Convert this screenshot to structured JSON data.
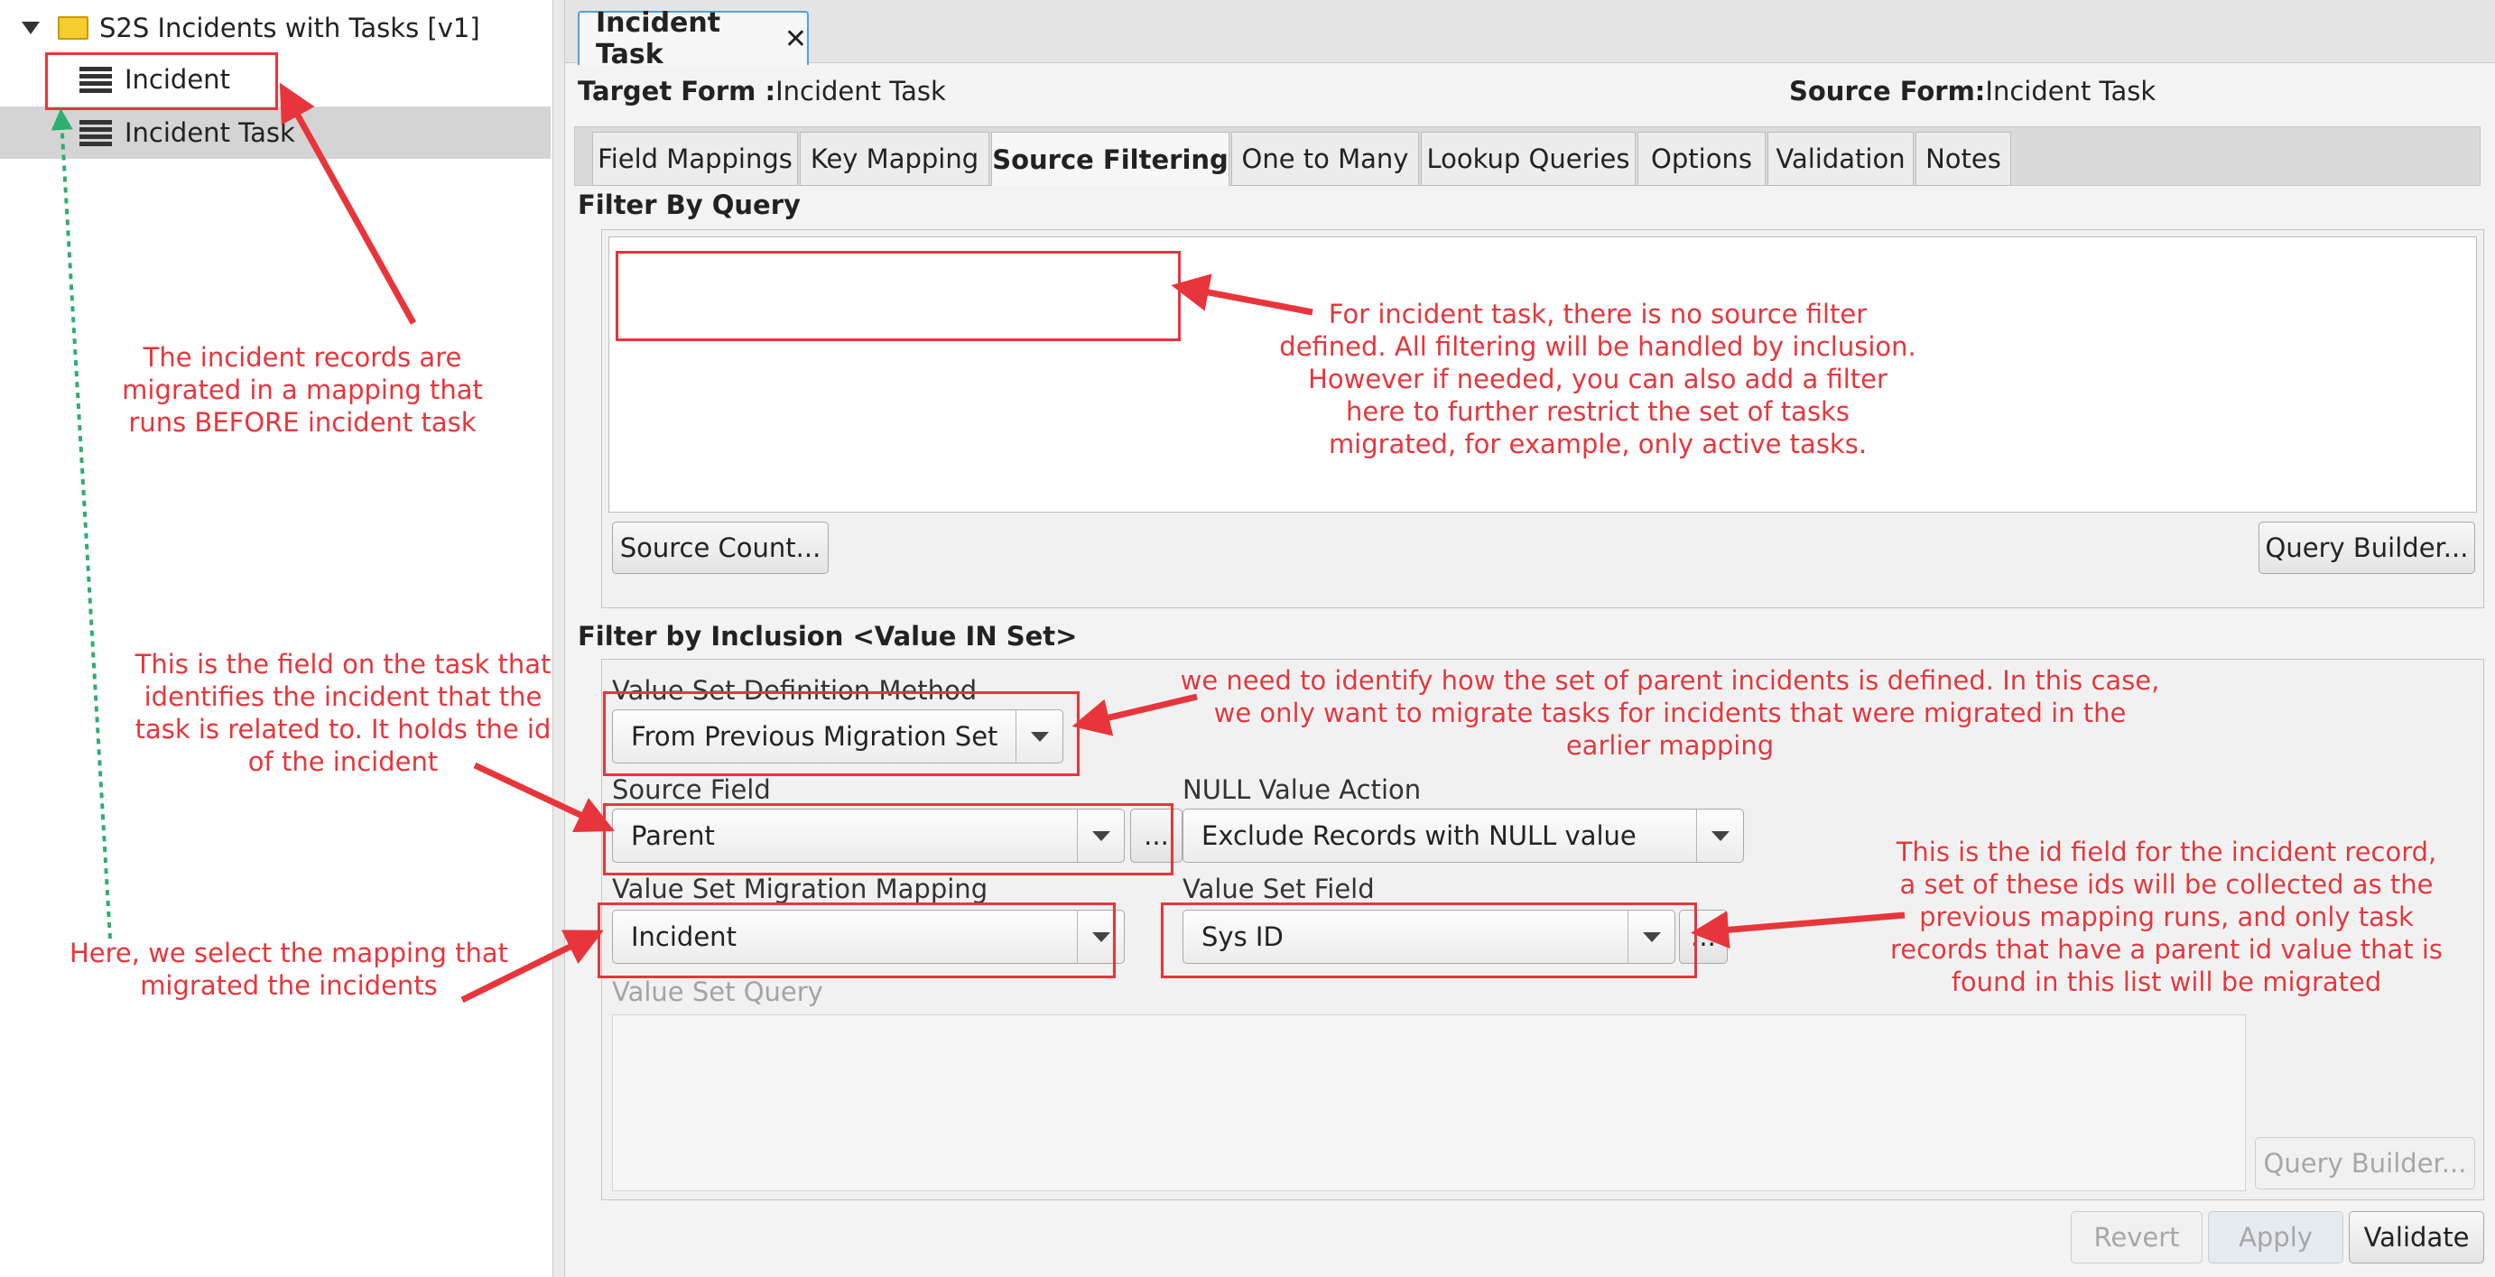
{
  "tree": {
    "root_label": "S2S Incidents with Tasks [v1]",
    "items": [
      {
        "label": "Incident"
      },
      {
        "label": "Incident Task"
      }
    ]
  },
  "document_tab": {
    "label": "Incident Task",
    "close": "✕"
  },
  "header": {
    "target_form_label": "Target Form :",
    "target_form_value": "Incident Task",
    "source_form_label": "Source Form:",
    "source_form_value": "Incident Task"
  },
  "tabs": [
    {
      "label": "Field Mappings"
    },
    {
      "label": "Key Mapping"
    },
    {
      "label": "Source Filtering"
    },
    {
      "label": "One to Many"
    },
    {
      "label": "Lookup Queries"
    },
    {
      "label": "Options"
    },
    {
      "label": "Validation"
    },
    {
      "label": "Notes"
    }
  ],
  "filter_by_query": {
    "title": "Filter By Query",
    "query_value": "",
    "source_count_button": "Source Count...",
    "query_builder_button": "Query Builder..."
  },
  "filter_by_inclusion": {
    "title": "Filter by Inclusion <Value IN Set>",
    "value_set_definition_method_label": "Value Set Definition Method",
    "value_set_definition_method_value": "From Previous Migration Set",
    "source_field_label": "Source Field",
    "source_field_value": "Parent",
    "ellipsis": "...",
    "null_value_action_label": "NULL Value Action",
    "null_value_action_value": "Exclude Records with NULL value",
    "value_set_migration_mapping_label": "Value Set Migration Mapping",
    "value_set_migration_mapping_value": "Incident",
    "value_set_field_label": "Value Set Field",
    "value_set_field_value": "Sys ID",
    "value_set_query_label": "Value Set Query",
    "query_builder_button": "Query Builder..."
  },
  "footer": {
    "revert": "Revert",
    "apply": "Apply",
    "validate": "Validate"
  },
  "annotations": {
    "incident_note": [
      "The incident records are",
      "migrated in a mapping that",
      "runs BEFORE incident task"
    ],
    "source_filter_note": [
      "For incident task, there is no source filter",
      "defined. All filtering will be handled by inclusion.",
      "However if needed, you can also add a filter",
      "here to further restrict the set of tasks",
      "migrated, for example, only active tasks."
    ],
    "field_note": [
      "This is the field on the task that",
      "identifies the incident that the",
      "task is related to. It holds the id",
      "of the incident"
    ],
    "value_set_note": [
      "we need to identify how the set of parent incidents is defined. In this case,",
      "we only want to migrate tasks for incidents that were migrated in the",
      "earlier mapping"
    ],
    "mapping_note": [
      "Here, we select the mapping that",
      "migrated the incidents"
    ],
    "id_field_note": [
      "This is the id field for the incident record,",
      "a set of these ids will be collected as the",
      "previous mapping runs, and only task",
      "records that have a parent id value that is",
      "found in this list will be migrated"
    ]
  },
  "colors": {
    "annotation_red": "#e8353b",
    "selected_row": "#d4d4d4",
    "tab_focus": "#4da3d9",
    "dotted_arrow": "#2fae6f"
  }
}
